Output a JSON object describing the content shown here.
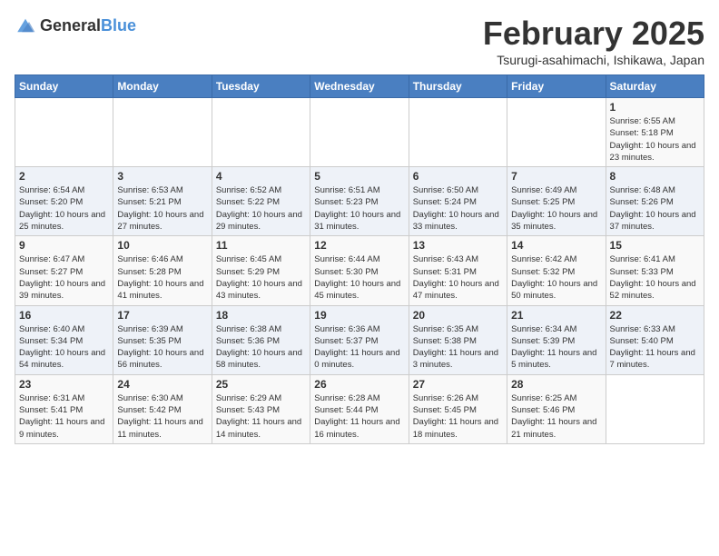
{
  "logo": {
    "general": "General",
    "blue": "Blue"
  },
  "title": "February 2025",
  "location": "Tsurugi-asahimachi, Ishikawa, Japan",
  "weekdays": [
    "Sunday",
    "Monday",
    "Tuesday",
    "Wednesday",
    "Thursday",
    "Friday",
    "Saturday"
  ],
  "weeks": [
    [
      {
        "day": "",
        "info": ""
      },
      {
        "day": "",
        "info": ""
      },
      {
        "day": "",
        "info": ""
      },
      {
        "day": "",
        "info": ""
      },
      {
        "day": "",
        "info": ""
      },
      {
        "day": "",
        "info": ""
      },
      {
        "day": "1",
        "info": "Sunrise: 6:55 AM\nSunset: 5:18 PM\nDaylight: 10 hours and 23 minutes."
      }
    ],
    [
      {
        "day": "2",
        "info": "Sunrise: 6:54 AM\nSunset: 5:20 PM\nDaylight: 10 hours and 25 minutes."
      },
      {
        "day": "3",
        "info": "Sunrise: 6:53 AM\nSunset: 5:21 PM\nDaylight: 10 hours and 27 minutes."
      },
      {
        "day": "4",
        "info": "Sunrise: 6:52 AM\nSunset: 5:22 PM\nDaylight: 10 hours and 29 minutes."
      },
      {
        "day": "5",
        "info": "Sunrise: 6:51 AM\nSunset: 5:23 PM\nDaylight: 10 hours and 31 minutes."
      },
      {
        "day": "6",
        "info": "Sunrise: 6:50 AM\nSunset: 5:24 PM\nDaylight: 10 hours and 33 minutes."
      },
      {
        "day": "7",
        "info": "Sunrise: 6:49 AM\nSunset: 5:25 PM\nDaylight: 10 hours and 35 minutes."
      },
      {
        "day": "8",
        "info": "Sunrise: 6:48 AM\nSunset: 5:26 PM\nDaylight: 10 hours and 37 minutes."
      }
    ],
    [
      {
        "day": "9",
        "info": "Sunrise: 6:47 AM\nSunset: 5:27 PM\nDaylight: 10 hours and 39 minutes."
      },
      {
        "day": "10",
        "info": "Sunrise: 6:46 AM\nSunset: 5:28 PM\nDaylight: 10 hours and 41 minutes."
      },
      {
        "day": "11",
        "info": "Sunrise: 6:45 AM\nSunset: 5:29 PM\nDaylight: 10 hours and 43 minutes."
      },
      {
        "day": "12",
        "info": "Sunrise: 6:44 AM\nSunset: 5:30 PM\nDaylight: 10 hours and 45 minutes."
      },
      {
        "day": "13",
        "info": "Sunrise: 6:43 AM\nSunset: 5:31 PM\nDaylight: 10 hours and 47 minutes."
      },
      {
        "day": "14",
        "info": "Sunrise: 6:42 AM\nSunset: 5:32 PM\nDaylight: 10 hours and 50 minutes."
      },
      {
        "day": "15",
        "info": "Sunrise: 6:41 AM\nSunset: 5:33 PM\nDaylight: 10 hours and 52 minutes."
      }
    ],
    [
      {
        "day": "16",
        "info": "Sunrise: 6:40 AM\nSunset: 5:34 PM\nDaylight: 10 hours and 54 minutes."
      },
      {
        "day": "17",
        "info": "Sunrise: 6:39 AM\nSunset: 5:35 PM\nDaylight: 10 hours and 56 minutes."
      },
      {
        "day": "18",
        "info": "Sunrise: 6:38 AM\nSunset: 5:36 PM\nDaylight: 10 hours and 58 minutes."
      },
      {
        "day": "19",
        "info": "Sunrise: 6:36 AM\nSunset: 5:37 PM\nDaylight: 11 hours and 0 minutes."
      },
      {
        "day": "20",
        "info": "Sunrise: 6:35 AM\nSunset: 5:38 PM\nDaylight: 11 hours and 3 minutes."
      },
      {
        "day": "21",
        "info": "Sunrise: 6:34 AM\nSunset: 5:39 PM\nDaylight: 11 hours and 5 minutes."
      },
      {
        "day": "22",
        "info": "Sunrise: 6:33 AM\nSunset: 5:40 PM\nDaylight: 11 hours and 7 minutes."
      }
    ],
    [
      {
        "day": "23",
        "info": "Sunrise: 6:31 AM\nSunset: 5:41 PM\nDaylight: 11 hours and 9 minutes."
      },
      {
        "day": "24",
        "info": "Sunrise: 6:30 AM\nSunset: 5:42 PM\nDaylight: 11 hours and 11 minutes."
      },
      {
        "day": "25",
        "info": "Sunrise: 6:29 AM\nSunset: 5:43 PM\nDaylight: 11 hours and 14 minutes."
      },
      {
        "day": "26",
        "info": "Sunrise: 6:28 AM\nSunset: 5:44 PM\nDaylight: 11 hours and 16 minutes."
      },
      {
        "day": "27",
        "info": "Sunrise: 6:26 AM\nSunset: 5:45 PM\nDaylight: 11 hours and 18 minutes."
      },
      {
        "day": "28",
        "info": "Sunrise: 6:25 AM\nSunset: 5:46 PM\nDaylight: 11 hours and 21 minutes."
      },
      {
        "day": "",
        "info": ""
      }
    ]
  ]
}
